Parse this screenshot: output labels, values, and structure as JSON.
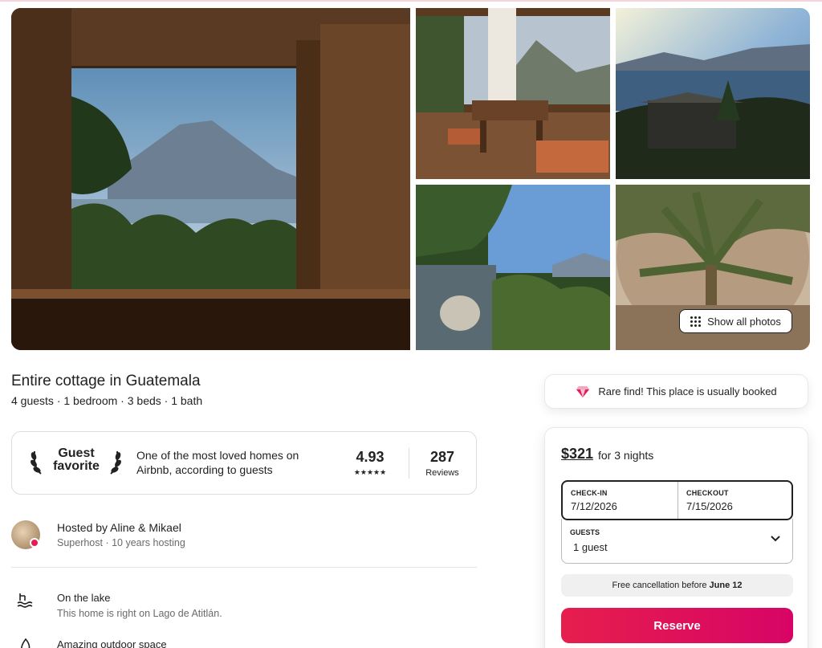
{
  "gallery": {
    "show_all_label": "Show all photos"
  },
  "listing": {
    "title": "Entire cottage in Guatemala",
    "summary": "4 guests · 1 bedroom · 3 beds · 1 bath"
  },
  "guest_favorite": {
    "label_line1": "Guest",
    "label_line2": "favorite",
    "description": "One of the most loved homes on Airbnb, according to guests",
    "rating": "4.93",
    "stars": "★★★★★",
    "reviews_count": "287",
    "reviews_label": "Reviews"
  },
  "host": {
    "name": "Hosted by Aline & Mikael",
    "details": "Superhost · 10 years hosting"
  },
  "features": [
    {
      "icon": "lake-icon",
      "title": "On the lake",
      "description": "This home is right on Lago de Atitlán."
    },
    {
      "icon": "fire-icon",
      "title": "Amazing outdoor space",
      "description": ""
    }
  ],
  "rare_find": {
    "icon": "diamond-icon",
    "text": "Rare find! This place is usually booked"
  },
  "booking": {
    "price": "$321",
    "price_suffix": "for 3 nights",
    "checkin_label": "CHECK-IN",
    "checkin_value": "7/12/2026",
    "checkout_label": "CHECKOUT",
    "checkout_value": "7/15/2026",
    "guests_label": "GUESTS",
    "guests_value": "1 guest",
    "cancellation_prefix": "Free cancellation before",
    "cancellation_date": "June 12",
    "reserve_label": "Reserve"
  },
  "colors": {
    "brand": "#e61e4d",
    "muted_text": "#6a6a6a",
    "border": "#dddddd"
  }
}
